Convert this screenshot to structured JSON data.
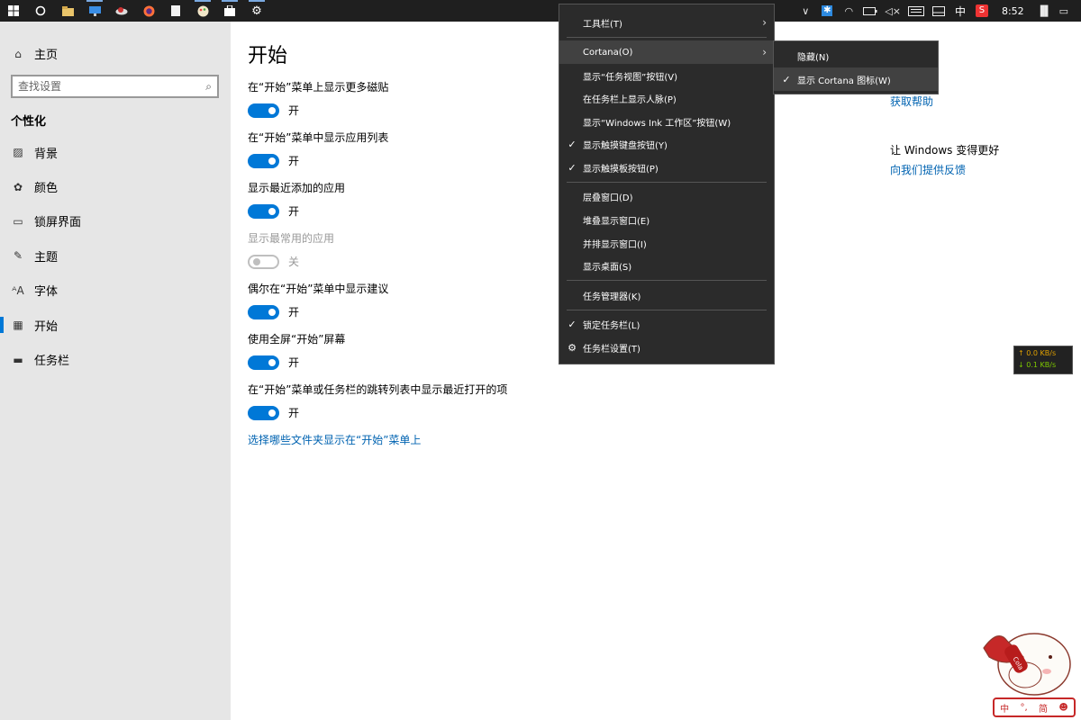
{
  "taskbar": {
    "time": "8:52",
    "ime_lang": "中",
    "left_icons": [
      "windows-logo-icon",
      "cortana-circle-icon",
      "file-explorer-icon",
      "remote-desktop-icon",
      "cloud-app-icon",
      "firefox-icon",
      "document-icon",
      "paint-app-icon",
      "store-bag-icon",
      "settings-gear-icon"
    ],
    "tray_icons": [
      "chevron-up-icon",
      "app-tray-icon",
      "wifi-icon",
      "battery-icon",
      "volume-mute-icon",
      "keyboard-icon",
      "touchpad-icon",
      "sogou-input-icon",
      "taskmgr-icon",
      "action-center-icon"
    ]
  },
  "sidebar": {
    "home": "主页",
    "search_placeholder": "查找设置",
    "section": "个性化",
    "items": [
      {
        "label": "背景",
        "icon": "picture-icon"
      },
      {
        "label": "颜色",
        "icon": "palette-icon"
      },
      {
        "label": "锁屏界面",
        "icon": "lock-screen-icon"
      },
      {
        "label": "主题",
        "icon": "theme-brush-icon"
      },
      {
        "label": "字体",
        "icon": "font-icon"
      },
      {
        "label": "开始",
        "icon": "start-menu-icon"
      },
      {
        "label": "任务栏",
        "icon": "taskbar-icon"
      }
    ]
  },
  "main": {
    "title": "开始",
    "settings": [
      {
        "label": "在“开始”菜单上显示更多磁贴",
        "state": "开",
        "on": true,
        "disabled": false
      },
      {
        "label": "在“开始”菜单中显示应用列表",
        "state": "开",
        "on": true,
        "disabled": false
      },
      {
        "label": "显示最近添加的应用",
        "state": "开",
        "on": true,
        "disabled": false
      },
      {
        "label": "显示最常用的应用",
        "state": "关",
        "on": false,
        "disabled": true
      },
      {
        "label": "偶尔在“开始”菜单中显示建议",
        "state": "开",
        "on": true,
        "disabled": false
      },
      {
        "label": "使用全屏“开始”屏幕",
        "state": "开",
        "on": true,
        "disabled": false
      },
      {
        "label": "在“开始”菜单或任务栏的跳转列表中显示最近打开的项",
        "state": "开",
        "on": true,
        "disabled": false
      }
    ],
    "folders_link": "选择哪些文件夹显示在“开始”菜单上"
  },
  "right": {
    "help_link": "获取帮助",
    "improve_text": "让 Windows 变得更好",
    "feedback_link": "向我们提供反馈"
  },
  "context_menu": {
    "items": [
      {
        "label": "工具栏(T)",
        "submenu": true,
        "checked": false
      },
      {
        "label": "Cortana(O)",
        "submenu": true,
        "checked": false,
        "hover": true
      },
      {
        "label": "显示“任务视图”按钮(V)",
        "checked": false
      },
      {
        "label": "在任务栏上显示人脉(P)",
        "checked": false
      },
      {
        "label": "显示“Windows Ink 工作区”按钮(W)",
        "checked": false
      },
      {
        "label": "显示触摸键盘按钮(Y)",
        "checked": true
      },
      {
        "label": "显示触摸板按钮(P)",
        "checked": true
      },
      {
        "label": "层叠窗口(D)",
        "checked": false
      },
      {
        "label": "堆叠显示窗口(E)",
        "checked": false
      },
      {
        "label": "并排显示窗口(I)",
        "checked": false
      },
      {
        "label": "显示桌面(S)",
        "checked": false
      },
      {
        "label": "任务管理器(K)",
        "checked": false
      },
      {
        "label": "锁定任务栏(L)",
        "checked": true
      },
      {
        "label": "任务栏设置(T)",
        "checked": false,
        "gear": true
      }
    ],
    "submenu": [
      {
        "label": "隐藏(N)",
        "checked": false
      },
      {
        "label": "显示 Cortana 图标(W)",
        "checked": true
      }
    ]
  },
  "netspeed": {
    "up": "↑ 0.0 KB/s",
    "down": "↓ 0.1 KB/s"
  },
  "mascot": {
    "bottle_text": "Cola"
  },
  "ime_bar": {
    "items": [
      "中",
      "°,",
      "简",
      "☻"
    ]
  }
}
